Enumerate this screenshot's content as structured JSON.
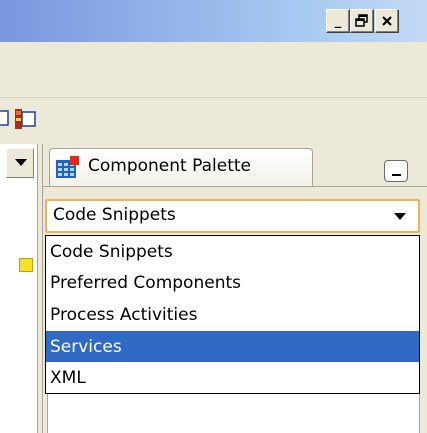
{
  "window": {
    "minimize_glyph": "_",
    "maximize_glyph": "🗗",
    "close_glyph": "✕"
  },
  "palette": {
    "tab_label": "Component Palette",
    "selected_value": "Code Snippets",
    "options": [
      "Code Snippets",
      "Preferred Components",
      "Process Activities",
      "Services",
      "XML"
    ],
    "highlighted_index": 3
  },
  "colors": {
    "highlight": "#316ac5",
    "focus_border": "#e8b35a"
  }
}
